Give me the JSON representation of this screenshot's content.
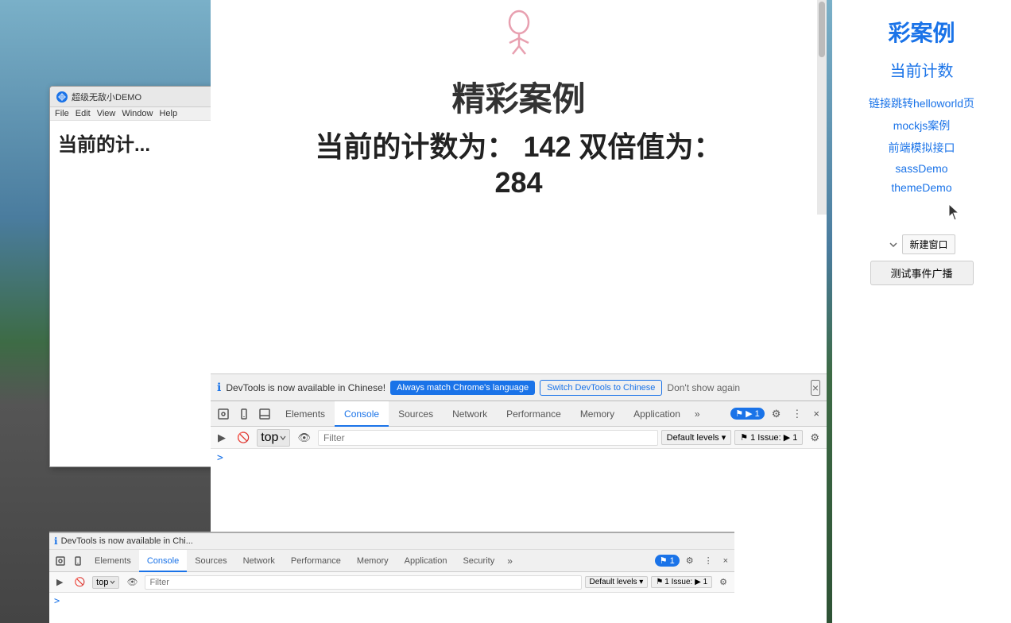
{
  "desktop": {
    "background_note": "road and sky scene"
  },
  "web_right": {
    "title": "彩案例",
    "subtitle": "当前计数",
    "links": [
      "链接跳转helloworld页",
      "mockjs案例",
      "前端模拟接口",
      "sassDemo",
      "themeDemo"
    ],
    "new_window_label": "新建窗口",
    "event_btn_label": "测试事件广播"
  },
  "main_page": {
    "icon": "🧘",
    "title": "精彩案例",
    "counter_label": "当前的计数为：",
    "counter_value": "142",
    "double_label": "双倍值为：",
    "double_value": "284"
  },
  "devtools_notification": {
    "icon": "ℹ",
    "text": "DevTools is now available in Chinese!",
    "btn_always": "Always match Chrome's language",
    "btn_switch": "Switch DevTools to Chinese",
    "dismiss": "Don't show again",
    "close": "×"
  },
  "devtools_main": {
    "tabs": [
      {
        "label": "Elements",
        "active": false
      },
      {
        "label": "Console",
        "active": true
      },
      {
        "label": "Sources",
        "active": false
      },
      {
        "label": "Network",
        "active": false
      },
      {
        "label": "Performance",
        "active": false
      },
      {
        "label": "Memory",
        "active": false
      },
      {
        "label": "Application",
        "active": false
      },
      {
        "label": "»",
        "active": false
      }
    ],
    "badge": "▶ 1",
    "top_selector": "top",
    "filter_placeholder": "Filter",
    "levels_label": "Default levels ▾",
    "issue_label": "1 Issue: ▶ 1",
    "console_prompt": ">"
  },
  "small_browser": {
    "title": "超级无敌小DEMO",
    "menu_items": [
      "File",
      "Edit",
      "View",
      "Window",
      "Help"
    ],
    "counter_zh": "当前的计..."
  },
  "small_devtools": {
    "notification_text": "DevTools is now available in Chi...",
    "tabs": [
      {
        "label": "Elements",
        "active": false
      },
      {
        "label": "Console",
        "active": true
      },
      {
        "label": "Sources",
        "active": false
      },
      {
        "label": "Network",
        "active": false
      },
      {
        "label": "Performance",
        "active": false
      },
      {
        "label": "Memory",
        "active": false
      },
      {
        "label": "Application",
        "active": false
      },
      {
        "label": "Security",
        "active": false
      },
      {
        "label": "»",
        "active": false
      }
    ],
    "top_selector": "top",
    "filter_placeholder": "Filter",
    "levels_label": "Default levels ▾",
    "issue_label": "1 Issue: ▶ 1",
    "console_prompt": ">"
  },
  "colors": {
    "accent": "#1a73e8",
    "tab_active": "#1a73e8",
    "bg_devtools": "#f5f5f5"
  }
}
